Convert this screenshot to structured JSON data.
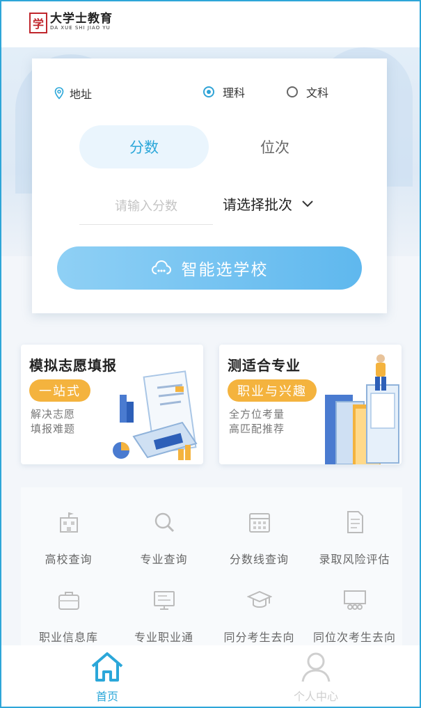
{
  "brand": {
    "seal": "学",
    "name_cn": "大学士教育",
    "name_en": "DA XUE SHI JIAO YU"
  },
  "search": {
    "address_label": "地址",
    "subject_options": [
      {
        "label": "理科",
        "selected": true
      },
      {
        "label": "文科",
        "selected": false
      }
    ],
    "tabs": [
      {
        "label": "分数",
        "active": true
      },
      {
        "label": "位次",
        "active": false
      }
    ],
    "score_placeholder": "请输入分数",
    "batch_label": "请选择批次",
    "submit_label": "智能选学校"
  },
  "features": [
    {
      "title": "模拟志愿填报",
      "badge": "一站式",
      "desc_line1": "解决志愿",
      "desc_line2": "填报难题"
    },
    {
      "title": "测适合专业",
      "badge": "职业与兴趣",
      "desc_line1": "全方位考量",
      "desc_line2": "高匹配推荐"
    }
  ],
  "grid": [
    {
      "label": "高校查询",
      "icon": "school-building-icon"
    },
    {
      "label": "专业查询",
      "icon": "magnifier-icon"
    },
    {
      "label": "分数线查询",
      "icon": "calendar-grid-icon"
    },
    {
      "label": "录取风险评估",
      "icon": "document-report-icon"
    },
    {
      "label": "职业信息库",
      "icon": "briefcase-icon"
    },
    {
      "label": "专业职业通",
      "icon": "monitor-icon"
    },
    {
      "label": "同分考生去向",
      "icon": "graduation-cap-icon"
    },
    {
      "label": "同位次考生去向",
      "icon": "group-board-icon"
    }
  ],
  "nav": [
    {
      "label": "首页",
      "active": true,
      "icon": "home-icon"
    },
    {
      "label": "个人中心",
      "active": false,
      "icon": "user-icon"
    }
  ],
  "colors": {
    "accent": "#2ba7d9",
    "badge": "#f4b33e",
    "button_from": "#8fd0f5",
    "button_to": "#5fb8ee"
  }
}
